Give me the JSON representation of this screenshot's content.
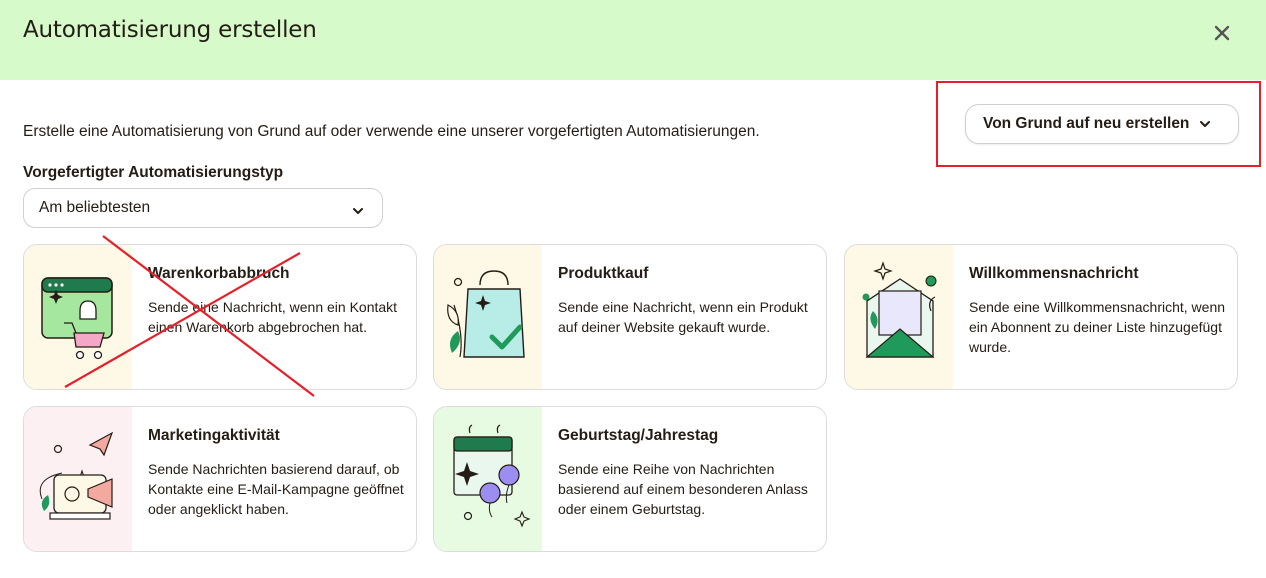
{
  "header": {
    "title": "Automatisierung erstellen",
    "close_icon": "close-icon",
    "background": "#d6fac9"
  },
  "intro": {
    "text": "Erstelle eine Automatisierung von Grund auf oder verwende eine unserer vorgefertigten Automatisierungen."
  },
  "create_button": {
    "label": "Von Grund auf neu erstellen",
    "icon": "chevron-down-icon"
  },
  "type_filter": {
    "label": "Vorgefertigter Automatisierungstyp",
    "selected": "Am beliebtesten",
    "icon": "chevron-down-icon"
  },
  "cards": [
    {
      "title": "Warenkorbabbruch",
      "description": "Sende eine Nachricht, wenn ein Kontakt einen Warenkorb abgebrochen hat.",
      "icon": "cart-bell-illustration",
      "thumb_color": "#fdf9e6"
    },
    {
      "title": "Produktkauf",
      "description": "Sende eine Nachricht, wenn ein Produkt auf deiner Website gekauft wurde.",
      "icon": "shopping-bag-illustration",
      "thumb_color": "#fdf9e6"
    },
    {
      "title": "Willkommensnachricht",
      "description": "Sende eine Willkommensnachricht, wenn ein Abonnent zu deiner Liste hinzugefügt wurde.",
      "icon": "envelope-illustration",
      "thumb_color": "#fdf9e6"
    },
    {
      "title": "Marketingaktivität",
      "description": "Sende Nachrichten basierend darauf, ob Kontakte eine E-Mail-Kampagne geöffnet oder angeklickt haben.",
      "icon": "megaphone-illustration",
      "thumb_color": "#fdf0f3"
    },
    {
      "title": "Geburtstag/Jahrestag",
      "description": "Sende eine Reihe von Nachrichten basierend auf einem besonderen Anlass oder einem Geburtstag.",
      "icon": "calendar-balloons-illustration",
      "thumb_color": "#e6fbe2"
    }
  ],
  "annotations": {
    "highlight_color": "#e4202a"
  }
}
